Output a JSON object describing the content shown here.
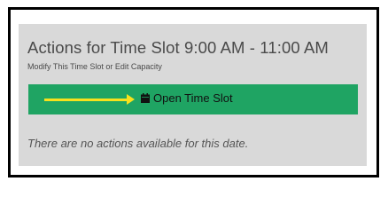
{
  "panel": {
    "title": "Actions for Time Slot 9:00 AM - 11:00 AM",
    "subtitle": "Modify This Time Slot or Edit Capacity",
    "open_slot_button": {
      "label": "Open Time Slot",
      "icon": "calendar-icon",
      "color": "#1fa463"
    },
    "annotation_arrow_color": "#f7e11c",
    "empty_message": "There are no actions available for this date."
  }
}
